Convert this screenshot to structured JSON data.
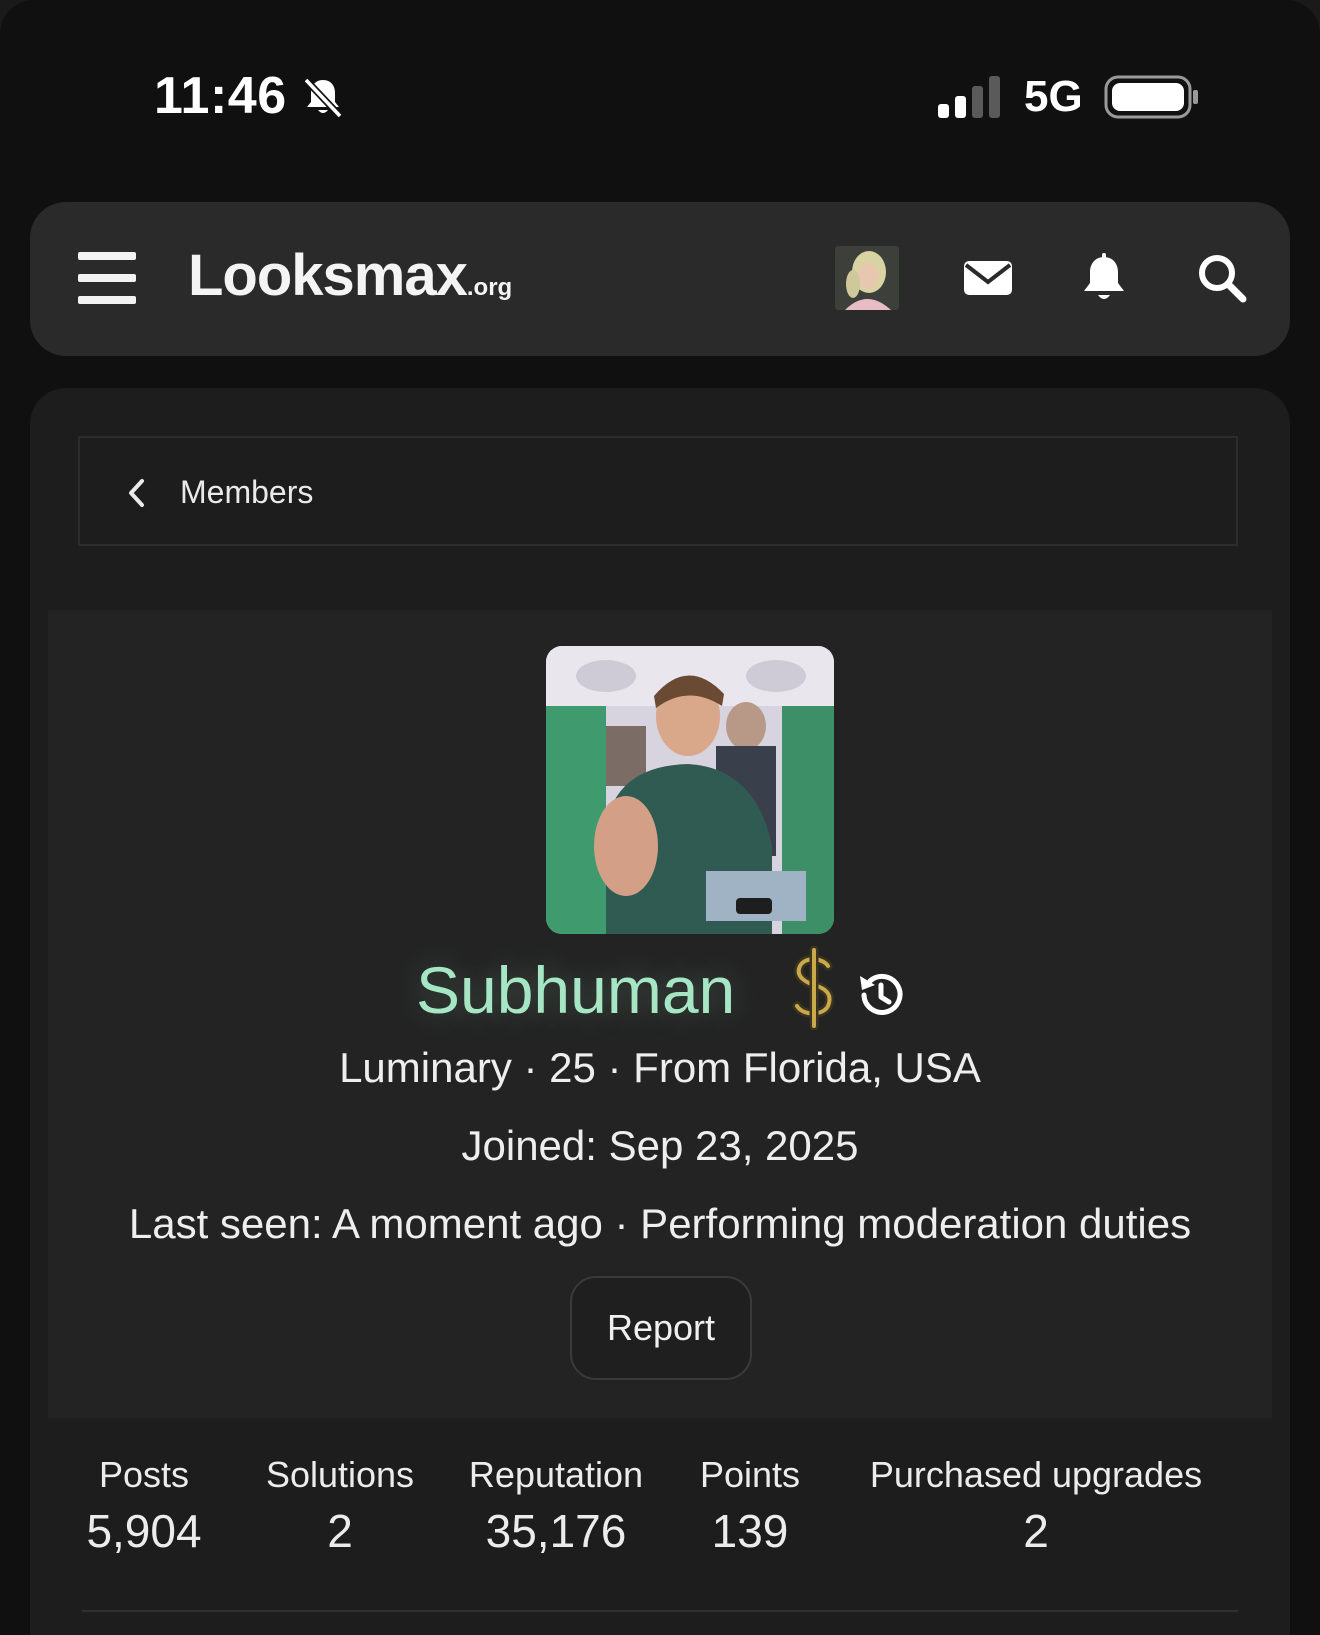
{
  "status_bar": {
    "time": "11:46",
    "network": "5G"
  },
  "header": {
    "logo_main": "Looksmax",
    "logo_tld": ".org",
    "icons": [
      "menu-icon",
      "avatar",
      "envelope-icon",
      "bell-icon",
      "search-icon"
    ]
  },
  "breadcrumb": {
    "label": "Members"
  },
  "profile": {
    "username": "Subhuman",
    "username_color": "#a6e6c4",
    "meta_line": "Luminary · 25 · From Florida, USA",
    "joined": "Joined: Sep 23, 2025",
    "last_seen": "Last seen: A moment ago · Performing moderation duties",
    "report_label": "Report"
  },
  "stats": [
    {
      "label": "Posts",
      "value": "5,904"
    },
    {
      "label": "Solutions",
      "value": "2"
    },
    {
      "label": "Reputation",
      "value": "35,176"
    },
    {
      "label": "Points",
      "value": "139"
    },
    {
      "label": "Purchased upgrades",
      "value": "2"
    }
  ]
}
